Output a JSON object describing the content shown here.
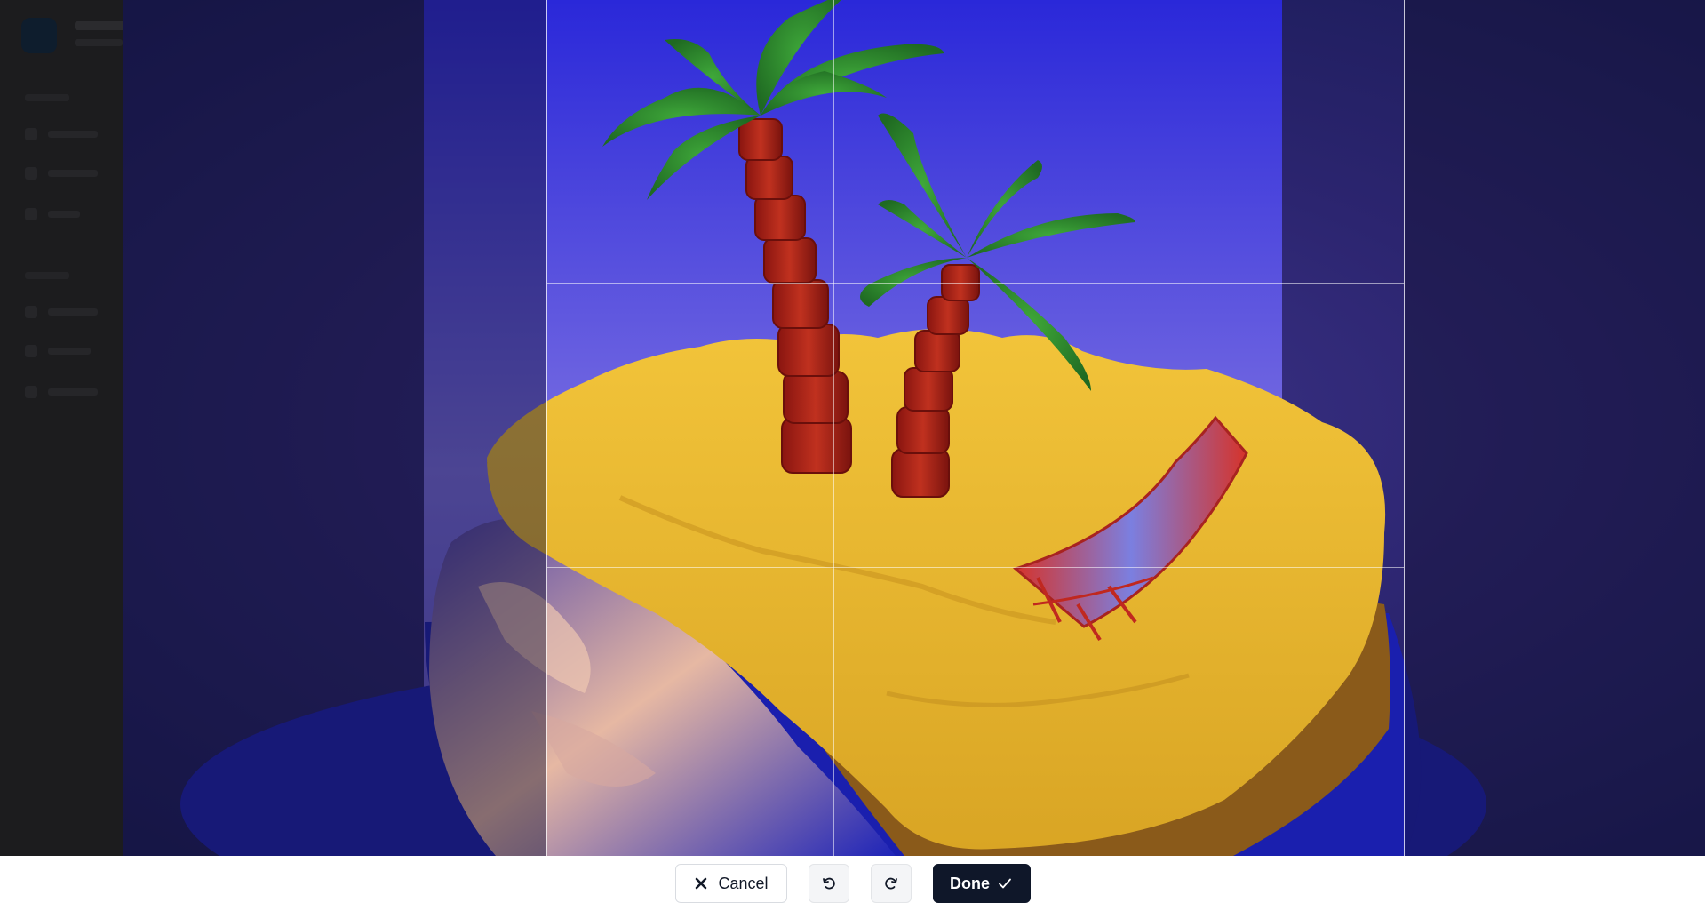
{
  "toolbar": {
    "cancel_label": "Cancel",
    "done_label": "Done",
    "cancel_icon": "close-icon",
    "rotate_left_icon": "rotate-counterclockwise-icon",
    "rotate_right_icon": "rotate-clockwise-icon",
    "done_icon": "check-icon"
  },
  "colors": {
    "done_background": "#0f1729",
    "canvas_background": "#2c2570",
    "sand": "#e7b52a",
    "palm_trunk": "#b3261e",
    "palm_leaf": "#2f8a2c",
    "water": "#1f23a8"
  }
}
